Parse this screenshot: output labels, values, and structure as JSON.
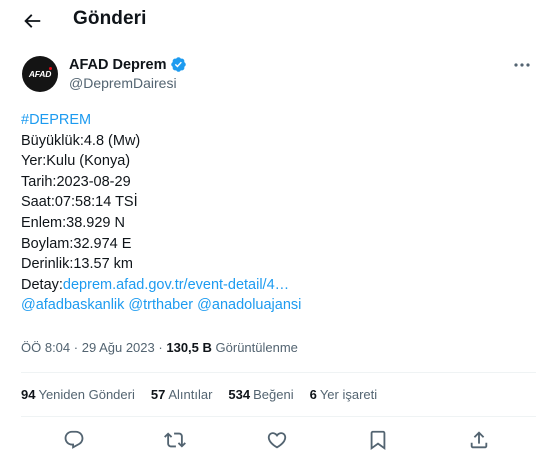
{
  "header": {
    "title": "Gönderi",
    "back_icon": "back-arrow-icon"
  },
  "author": {
    "avatar_text": "AFAD",
    "display_name": "AFAD Deprem",
    "handle": "@DepremDairesi",
    "verified_icon": "verified-badge-icon",
    "verified_color": "#1d9bf0"
  },
  "tweet": {
    "hashtag": "#DEPREM",
    "lines": [
      "Büyüklük:4.8 (Mw)",
      "Yer:Kulu (Konya)",
      "Tarih:2023-08-29",
      "Saat:07:58:14 TSİ",
      "Enlem:38.929 N",
      "Boylam:32.974 E",
      "Derinlik:13.57 km"
    ],
    "detail_label": "Detay:",
    "detail_link": "deprem.afad.gov.tr/event-detail/4…",
    "mentions": [
      "@afadbaskanlik",
      "@trthaber",
      "@anadoluajansi"
    ],
    "link_color": "#1d9bf0"
  },
  "meta": {
    "time": "ÖÖ 8:04",
    "dot": "·",
    "date": "29 Ağu 2023",
    "views": "130,5 B",
    "views_label": "Görüntülenme"
  },
  "stats": [
    {
      "count": "94",
      "label": "Yeniden Gönderi"
    },
    {
      "count": "57",
      "label": "Alıntılar"
    },
    {
      "count": "534",
      "label": "Beğeni"
    },
    {
      "count": "6",
      "label": "Yer işareti"
    }
  ],
  "actions": [
    "reply-icon",
    "retweet-icon",
    "like-icon",
    "bookmark-icon",
    "share-icon"
  ]
}
